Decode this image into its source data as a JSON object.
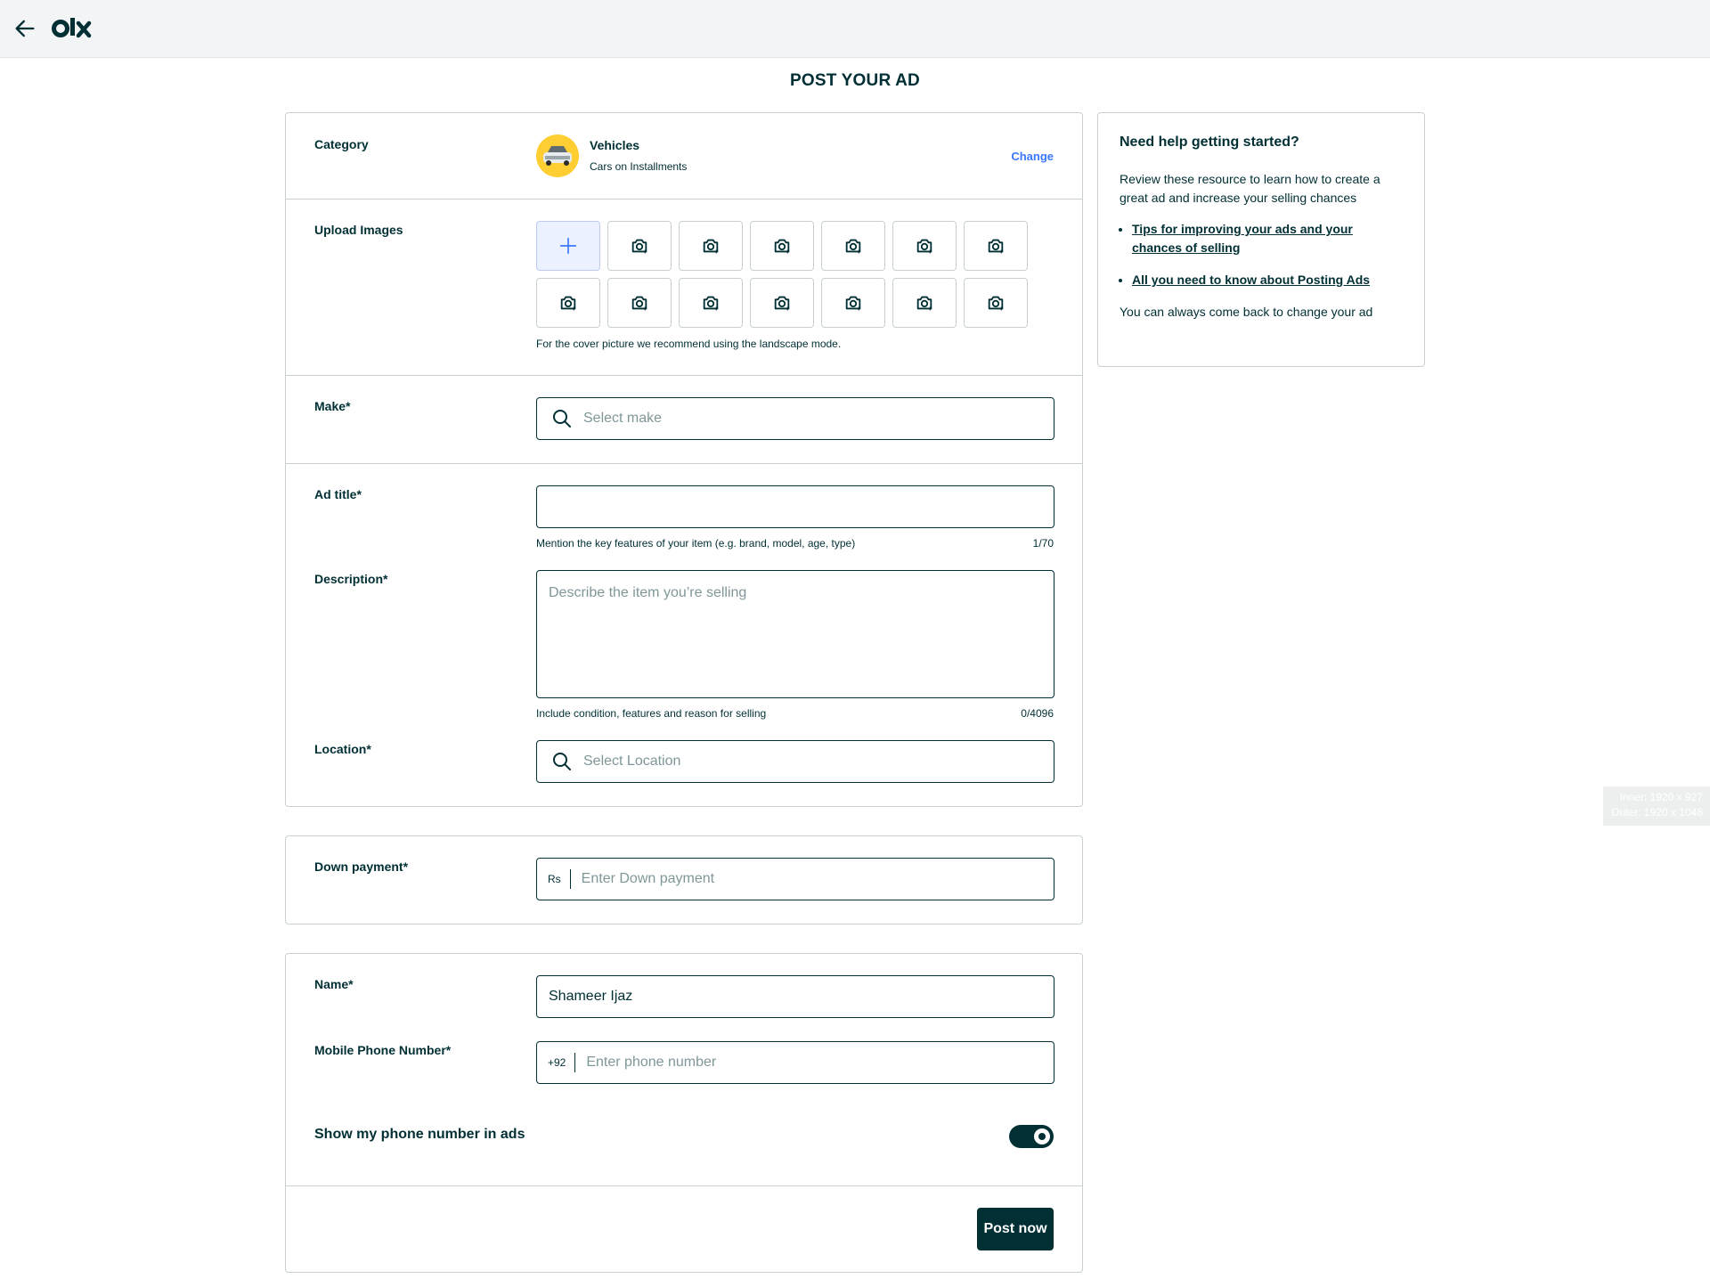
{
  "header": {
    "logo_text": "olx",
    "back_icon": "arrow-left-icon"
  },
  "page_title": "POST YOUR AD",
  "category": {
    "label": "Category",
    "name": "Vehicles",
    "subcategory": "Cars on Installments",
    "change_label": "Change"
  },
  "upload": {
    "label": "Upload Images",
    "hint": "For the cover picture we recommend using the landscape mode.",
    "slot_count": 14
  },
  "make": {
    "label": "Make*",
    "placeholder": "Select make"
  },
  "ad_title": {
    "label": "Ad title*",
    "value": "",
    "hint": "Mention the key features of your item (e.g. brand, model, age, type)",
    "counter": "1/70"
  },
  "description": {
    "label": "Description*",
    "placeholder": "Describe the item you’re selling",
    "hint": "Include condition, features and reason for selling",
    "counter": "0/4096"
  },
  "location": {
    "label": "Location*",
    "placeholder": "Select Location"
  },
  "down_payment": {
    "label": "Down payment*",
    "prefix": "Rs",
    "placeholder": "Enter Down payment"
  },
  "contact": {
    "name_label": "Name*",
    "name_value": "Shameer Ijaz",
    "phone_label": "Mobile Phone Number*",
    "phone_prefix": "+92",
    "phone_placeholder": "Enter phone number",
    "show_phone_label": "Show my phone number in ads",
    "show_phone_enabled": true
  },
  "post_button": "Post now",
  "help": {
    "title": "Need help getting started?",
    "intro": "Review these resource to learn how to create a great ad and increase your selling chances",
    "links": [
      "Tips for improving your ads and your chances of selling",
      "All you need to know about Posting Ads"
    ],
    "footer": "You can always come back to change your ad"
  },
  "viewport_overlay": {
    "inner": "Inner: 1920 x 927",
    "outer": "Outer: 1920 x 1048"
  },
  "colors": {
    "primary": "#002f34",
    "accent": "#3a77ff",
    "border": "#c7cfd1",
    "topbar": "#f2f4f5"
  }
}
